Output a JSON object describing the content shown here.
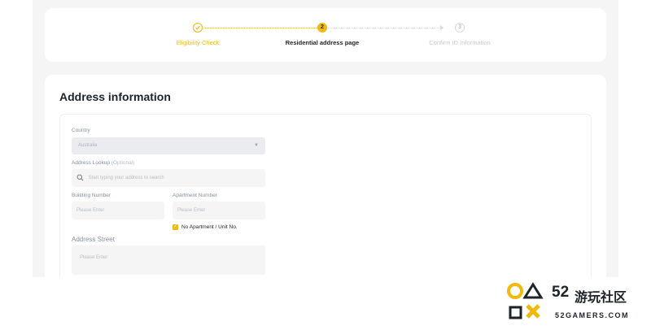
{
  "colors": {
    "accent": "#F0B90B",
    "page_bg": "#F5F5F5",
    "heading": "#1E2329",
    "muted": "#848E9C",
    "field_bg": "#F5F5F5"
  },
  "stepper": {
    "steps": [
      {
        "label": "Eligibility Check",
        "marker": "check-icon",
        "state": "done"
      },
      {
        "label": "Residential address page",
        "marker": "2",
        "state": "active"
      },
      {
        "label": "Confirm ID Information",
        "marker": "3",
        "state": "pending"
      }
    ]
  },
  "address": {
    "title": "Address information",
    "country": {
      "label": "Country",
      "value": "Australia",
      "icon": "chevron-down-icon"
    },
    "lookup": {
      "label": "Address Lookup",
      "label_optional": "(Optional)",
      "placeholder": "Start typing your address to search",
      "icon": "search-icon"
    },
    "building": {
      "label": "Building Number",
      "placeholder": "Please Enter"
    },
    "apartment": {
      "label": "Apartment Number",
      "placeholder": "Please Enter"
    },
    "no_apartment": {
      "label": "No Apartment / Unit No.",
      "checked": true
    },
    "street": {
      "label": "Address Street",
      "placeholder": "Please Enter"
    }
  },
  "watermark": {
    "number": "52",
    "chinese": "游玩社区",
    "site": "52GAMERS.COM"
  }
}
